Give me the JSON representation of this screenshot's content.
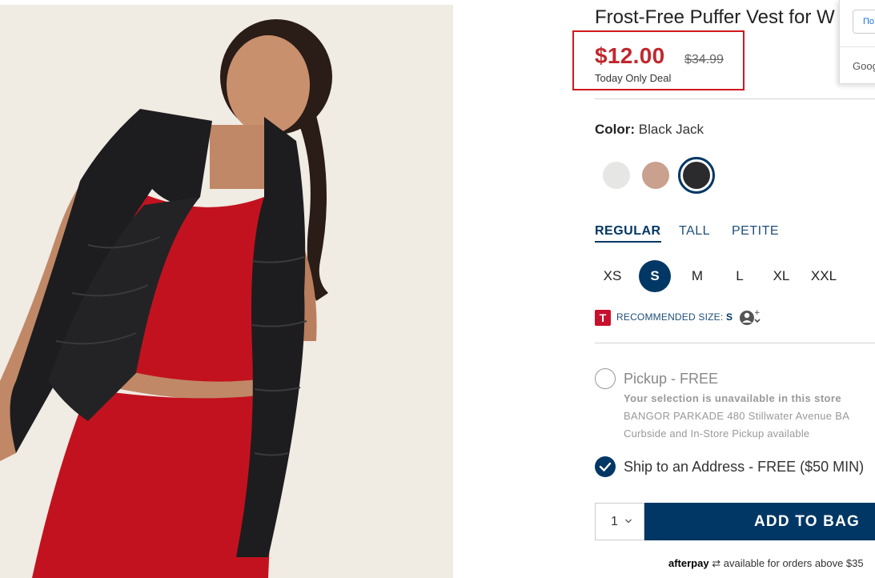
{
  "product": {
    "title": "Frost-Free Puffer Vest for W",
    "sale_price": "$12.00",
    "original_price": "$34.99",
    "deal_label": "Today Only Deal",
    "highlight_color": "#d0181f"
  },
  "color": {
    "label": "Color:",
    "selected_name": "Black Jack",
    "swatches": [
      {
        "name": "white",
        "hex": "#e6e6e4",
        "selected": false
      },
      {
        "name": "blush",
        "hex": "#c9a18e",
        "selected": false
      },
      {
        "name": "black-jack",
        "hex": "#2b2b2d",
        "selected": true
      }
    ]
  },
  "fit_tabs": [
    {
      "label": "REGULAR",
      "active": true
    },
    {
      "label": "TALL",
      "active": false
    },
    {
      "label": "PETITE",
      "active": false
    }
  ],
  "sizes": [
    {
      "label": "XS",
      "selected": false
    },
    {
      "label": "S",
      "selected": true
    },
    {
      "label": "M",
      "selected": false
    },
    {
      "label": "L",
      "selected": false
    },
    {
      "label": "XL",
      "selected": false
    },
    {
      "label": "XXL",
      "selected": false
    }
  ],
  "recommended": {
    "badge": "T",
    "label": "RECOMMENDED SIZE:",
    "size": "S",
    "avatar_plus": "+"
  },
  "fulfillment": {
    "pickup_label": "Pickup - FREE",
    "pickup_unavailable": "Your selection is unavailable in this store",
    "pickup_store": "BANGOR PARKADE 480 Stillwater Avenue BA",
    "pickup_note": "Curbside and In-Store Pickup available",
    "ship_label": "Ship to an Address - FREE ($50 MIN)",
    "ship_checked": true
  },
  "cart": {
    "quantity": "1",
    "add_button_label": "ADD TO BAG"
  },
  "afterpay": {
    "brand": "afterpay",
    "text": "available for orders above $35"
  },
  "popup": {
    "button_text": "По",
    "footer_text": "Goog"
  },
  "colors": {
    "navy": "#003764",
    "sale_red": "#c0282d",
    "badge_red": "#c8102e"
  }
}
